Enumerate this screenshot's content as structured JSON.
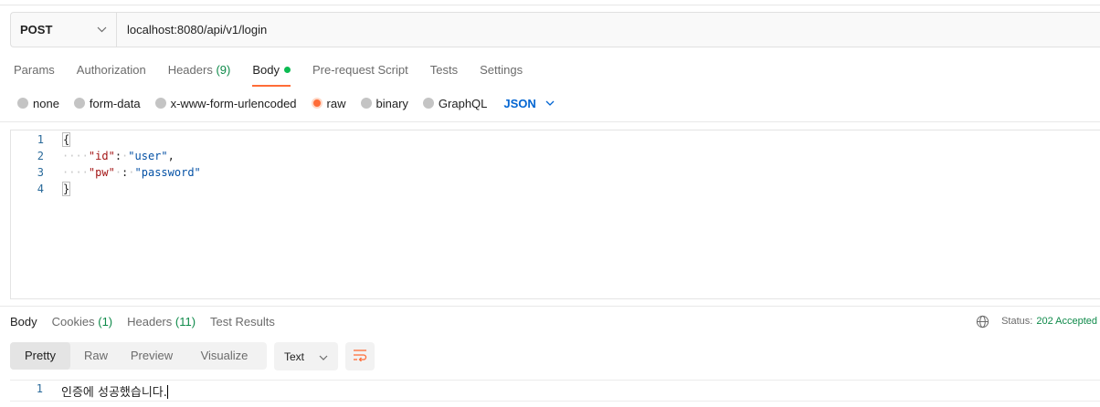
{
  "request": {
    "method": "POST",
    "url": "localhost:8080/api/v1/login"
  },
  "request_tabs": [
    {
      "label": "Params"
    },
    {
      "label": "Authorization"
    },
    {
      "label": "Headers",
      "count": "(9)"
    },
    {
      "label": "Body"
    },
    {
      "label": "Pre-request Script"
    },
    {
      "label": "Tests"
    },
    {
      "label": "Settings"
    }
  ],
  "body_types": [
    "none",
    "form-data",
    "x-www-form-urlencoded",
    "raw",
    "binary",
    "GraphQL"
  ],
  "body_format": "JSON",
  "editor": {
    "line_numbers": [
      "1",
      "2",
      "3",
      "4"
    ],
    "open_brace": "{",
    "close_brace": "}",
    "line2_ws": "····",
    "line2_key": "\"id\"",
    "line2_colon": ":",
    "line2_sp": "·",
    "line2_value": "\"user\"",
    "line2_comma": ",",
    "line3_ws": "····",
    "line3_key": "\"pw\"",
    "line3_sp1": "·",
    "line3_colon": ":",
    "line3_sp2": "·",
    "line3_value": "\"password\""
  },
  "response_tabs": [
    {
      "label": "Body"
    },
    {
      "label": "Cookies",
      "count": "(1)"
    },
    {
      "label": "Headers",
      "count": "(11)"
    },
    {
      "label": "Test Results"
    }
  ],
  "status": {
    "label": "Status:",
    "value": "202 Accepted"
  },
  "view_modes": [
    "Pretty",
    "Raw",
    "Preview",
    "Visualize"
  ],
  "response_format": "Text",
  "response_body": {
    "line_number": "1",
    "text": "인증에 성공했습니다."
  },
  "colors": {
    "accent": "#ff6c37",
    "json_blue": "#0265d2",
    "count_green": "#0f8a4a",
    "body_dot": "#0cbb52"
  },
  "icons": [
    "chevron-down-icon",
    "globe-icon",
    "wrap-lines-icon"
  ]
}
